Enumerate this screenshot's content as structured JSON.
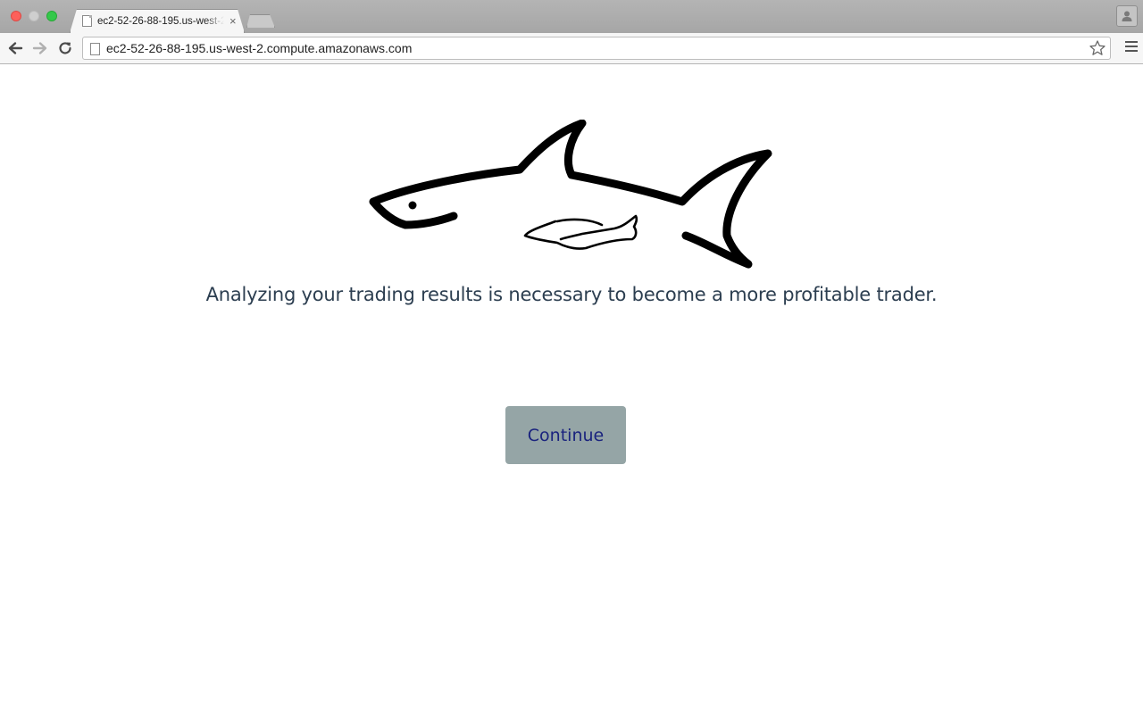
{
  "browser": {
    "tab_title": "ec2-52-26-88-195.us-west-2.compute.amazonaws.com",
    "tab_close_glyph": "×",
    "url": "ec2-52-26-88-195.us-west-2.compute.amazonaws.com",
    "icons": {
      "back": "arrow-left-icon",
      "forward": "arrow-right-icon",
      "reload": "reload-icon",
      "bookmark": "star-icon",
      "menu": "hamburger-menu-icon",
      "profile": "person-icon",
      "page": "page-icon"
    }
  },
  "page": {
    "logo": "shark-logo",
    "tagline": "Analyzing your trading results is necessary to become a more profitable trader.",
    "continue_label": "Continue"
  },
  "colors": {
    "tagline": "#2c3e50",
    "button_bg": "#95a5a6",
    "button_text": "#1a237e",
    "close_light": "#fc605b",
    "max_light": "#34c84a"
  }
}
